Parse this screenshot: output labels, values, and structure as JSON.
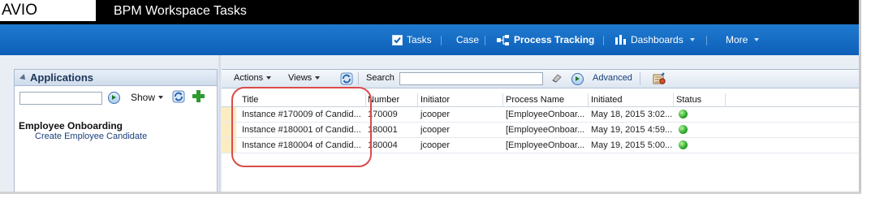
{
  "header": {
    "logo_text": "AVIO",
    "app_title": "BPM Workspace Tasks"
  },
  "nav": {
    "tasks": "Tasks",
    "case": "Case",
    "process_tracking": "Process Tracking",
    "dashboards": "Dashboards",
    "more": "More"
  },
  "applications": {
    "title": "Applications",
    "show_label": "Show",
    "group_name": "Employee Onboarding",
    "group_link": "Create Employee Candidate"
  },
  "toolbar": {
    "actions": "Actions",
    "views": "Views",
    "search_label": "Search",
    "advanced": "Advanced"
  },
  "table": {
    "columns": [
      "Title",
      "Number",
      "Initiator",
      "Process Name",
      "Initiated",
      "Status"
    ],
    "rows": [
      {
        "title": "Instance #170009 of Candid...",
        "number": "170009",
        "initiator": "jcooper",
        "process": "[EmployeeOnboar...",
        "initiated": "May 18, 2015 3:02...",
        "status": "green"
      },
      {
        "title": "Instance #180001 of Candid...",
        "number": "180001",
        "initiator": "jcooper",
        "process": "[EmployeeOnboar...",
        "initiated": "May 19, 2015 4:59...",
        "status": "green"
      },
      {
        "title": "Instance #180004 of Candid...",
        "number": "180004",
        "initiator": "jcooper",
        "process": "[EmployeeOnboar...",
        "initiated": "May 19, 2015 5:00...",
        "status": "green"
      }
    ]
  },
  "colors": {
    "header_bg": "#000000",
    "nav_bg": "#0d5fb8",
    "annotation": "#d94a4a",
    "status_ok": "#2aa52a"
  }
}
